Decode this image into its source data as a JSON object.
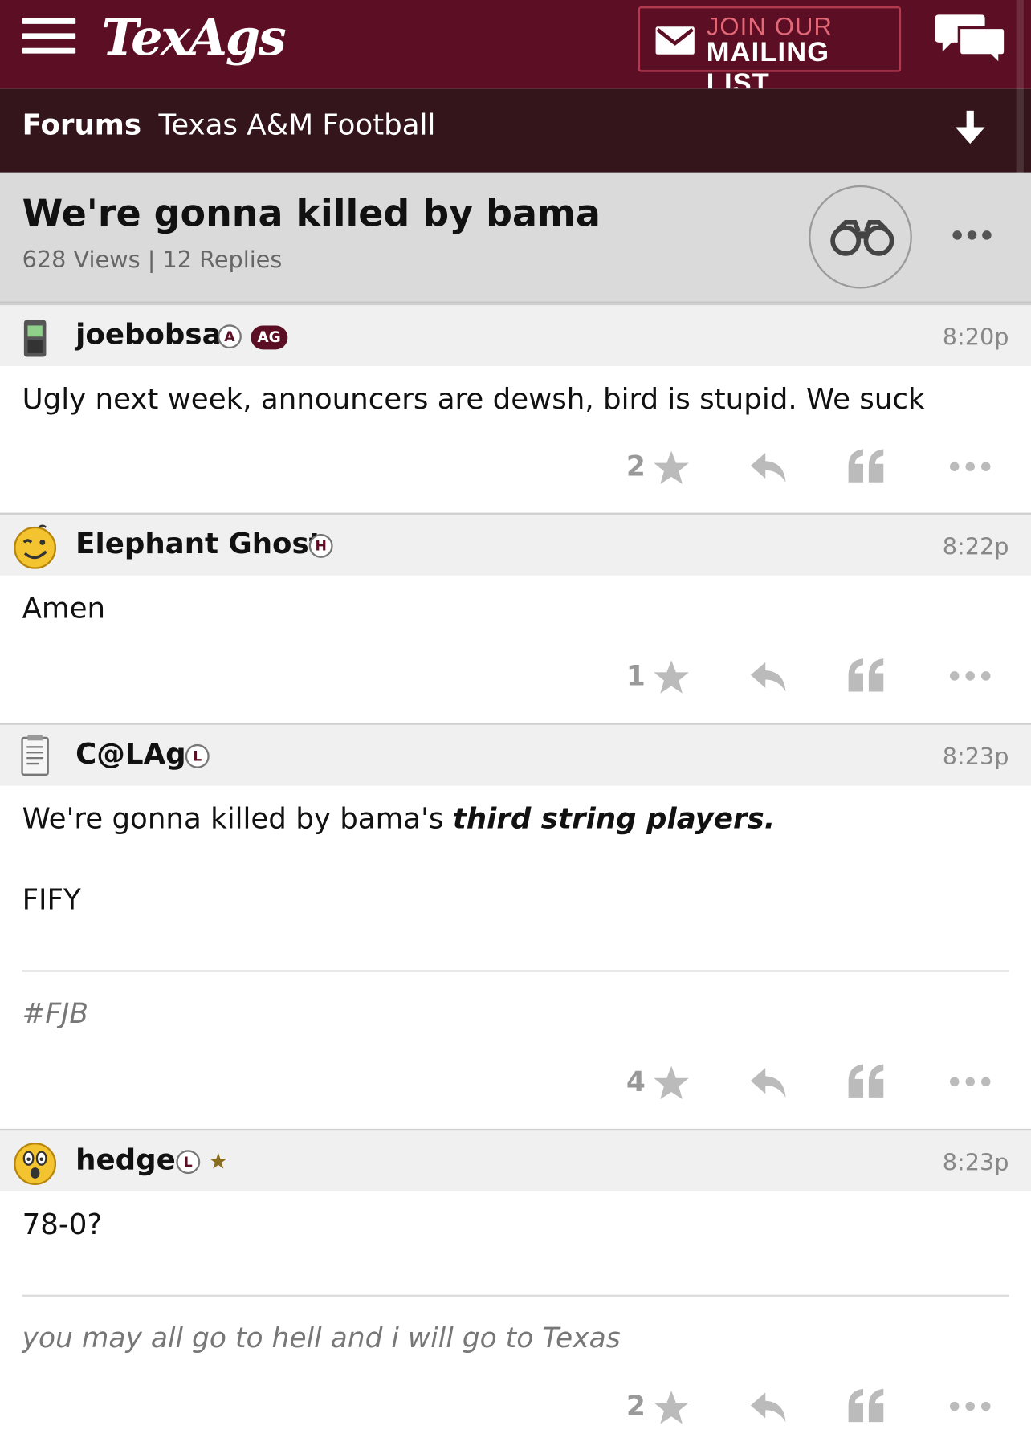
{
  "header": {
    "logo": "TexAgs",
    "mailing_list": {
      "line1": "JOIN OUR",
      "line2": "MAILING LIST"
    }
  },
  "breadcrumb": {
    "forums": "Forums",
    "board": "Texas A&M Football"
  },
  "thread": {
    "title": "We're gonna killed by bama",
    "stats": "628 Views | 12 Replies"
  },
  "posts": [
    {
      "username": "joebobsa",
      "badges": [
        "A",
        "AG"
      ],
      "time": "8:20p",
      "body": "Ugly next week, announcers are dewsh, bird is stupid. We suck",
      "rating": "2"
    },
    {
      "username": "Elephant Ghost",
      "badges": [
        "H"
      ],
      "time": "8:22p",
      "body": "Amen",
      "rating": "1"
    },
    {
      "username": "C@LAg",
      "badges": [
        "L"
      ],
      "time": "8:23p",
      "body_prefix": "We're gonna killed by bama's ",
      "body_emphasis": "third string players.",
      "body_line2": "FIFY",
      "signature": "#FJB",
      "rating": "4"
    },
    {
      "username": "hedge",
      "badges": [
        "L",
        "★"
      ],
      "time": "8:23p",
      "body": "78-0?",
      "signature": "you may all go to hell and i will go to Texas",
      "rating": "2"
    }
  ],
  "colors": {
    "maroon": "#5c0f24",
    "crumb_bg": "#33151b",
    "header_gray": "#dadada",
    "star_gold": "#8a6d1f"
  },
  "icons": [
    "menu-icon",
    "envelope-icon",
    "chat-bubbles-icon",
    "down-arrow-icon",
    "binoculars-icon",
    "more-icon",
    "star-icon",
    "reply-icon",
    "quote-icon"
  ]
}
